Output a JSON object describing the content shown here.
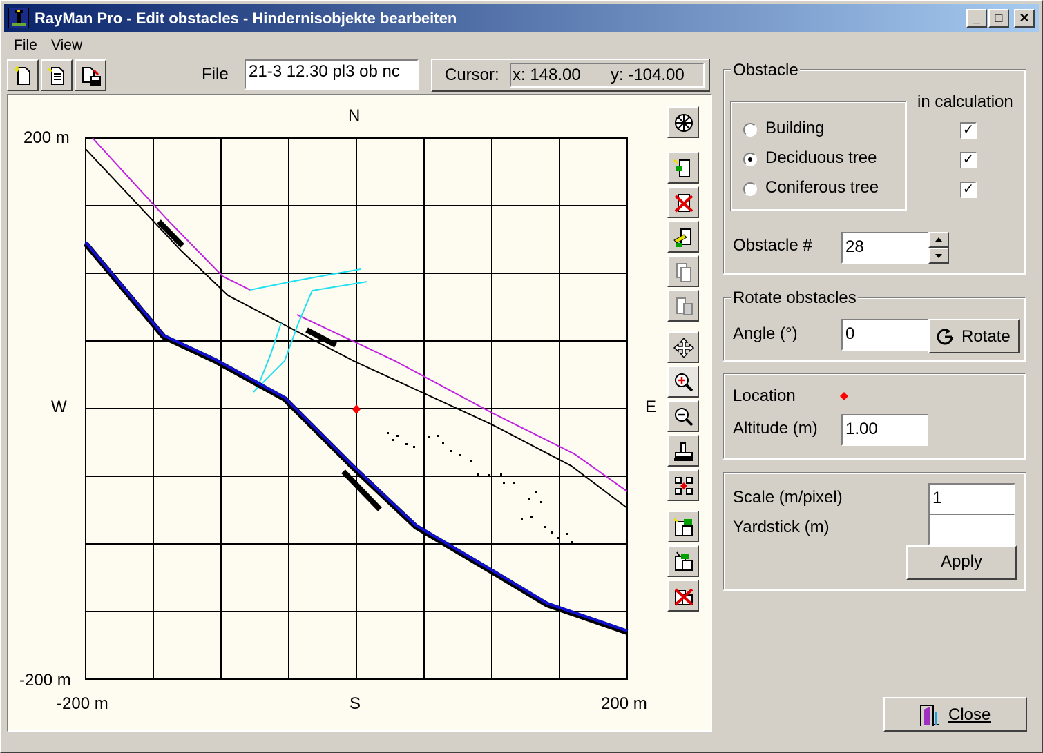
{
  "window": {
    "title": "RayMan Pro - Edit obstacles - Hindernisobjekte bearbeiten",
    "min_glyph": "_",
    "max_glyph": "□",
    "close_glyph": "✕"
  },
  "menu": {
    "file": "File",
    "view": "View"
  },
  "toolbar": {
    "file_label": "File",
    "file_value": "21-3   12.30 pl3 ob nc",
    "cursor_label": "Cursor:",
    "cursor_x": "x: 148.00",
    "cursor_y": "y: -104.00"
  },
  "map": {
    "north": "N",
    "south": "S",
    "west": "W",
    "east": "E",
    "y_top": "200 m",
    "y_bottom": "-200 m",
    "x_left": "-200 m",
    "x_right": "200 m"
  },
  "obstacle": {
    "title": "Obstacle",
    "in_calc": "in calculation",
    "building": "Building",
    "deciduous": "Deciduous tree",
    "coniferous": "Coniferous tree",
    "selected": "Deciduous tree",
    "building_checked": true,
    "deciduous_checked": true,
    "coniferous_checked": true,
    "number_label": "Obstacle #",
    "number_value": "28"
  },
  "rotate": {
    "title": "Rotate obstacles",
    "angle_label": "Angle (°)",
    "angle_value": "0",
    "button": "Rotate"
  },
  "location": {
    "label": "Location",
    "altitude_label": "Altitude (m)",
    "altitude_value": "1.00"
  },
  "scale": {
    "scale_label": "Scale (m/pixel)",
    "scale_value": "1",
    "yardstick_label": "Yardstick (m)",
    "yardstick_value": "",
    "apply": "Apply"
  },
  "close_button": "Close",
  "colors": {
    "title_bar": "#0a246a",
    "canvas_bg": "#fefcf0",
    "road": "#1010d0",
    "boundary": "#c020e0",
    "stream": "#20e0f0",
    "location_marker": "#ff0000"
  }
}
